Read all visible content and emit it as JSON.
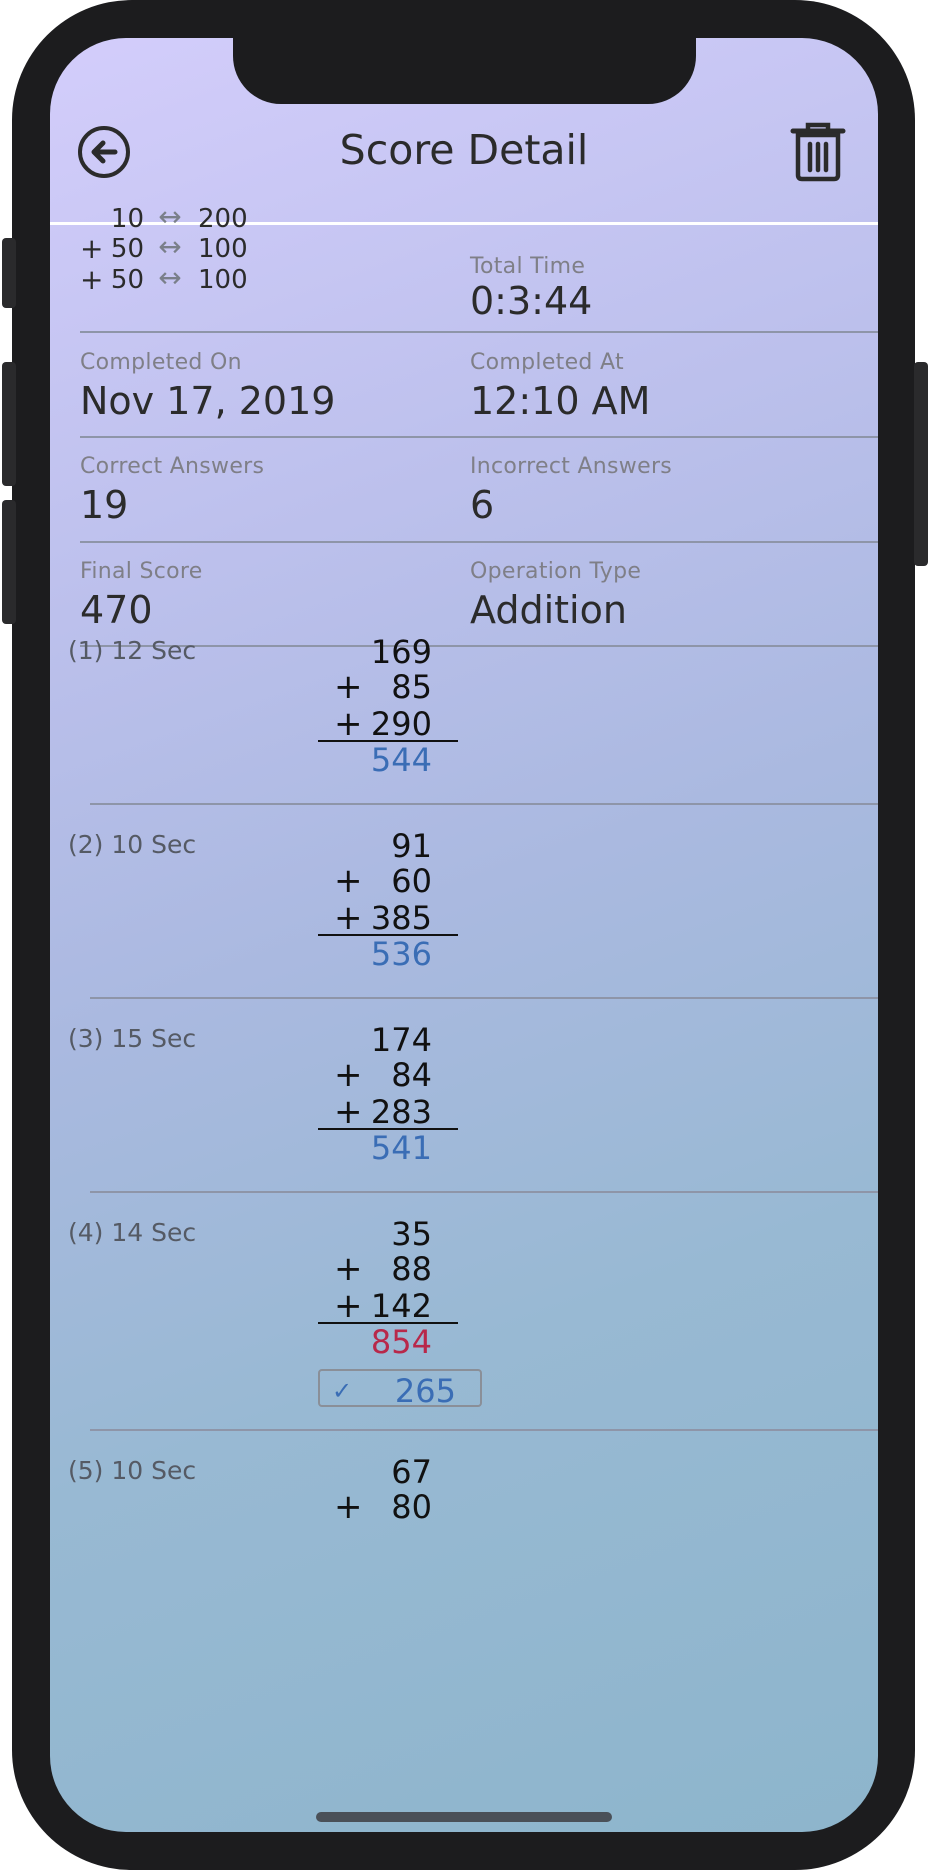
{
  "header": {
    "title": "Score Detail",
    "back_icon": "back-arrow-circle-icon",
    "delete_icon": "trash-icon"
  },
  "ranges": [
    {
      "plus": "",
      "low": "10",
      "high": "200"
    },
    {
      "plus": "+",
      "low": "50",
      "high": "100"
    },
    {
      "plus": "+",
      "low": "50",
      "high": "100"
    }
  ],
  "range_arrow": "↔",
  "stats": {
    "total_time_label": "Total Time",
    "total_time": "0:3:44",
    "completed_on_label": "Completed On",
    "completed_on": "Nov 17, 2019",
    "completed_at_label": "Completed At",
    "completed_at": "12:10 AM",
    "correct_label": "Correct Answers",
    "correct": "19",
    "incorrect_label": "Incorrect Answers",
    "incorrect": "6",
    "final_score_label": "Final Score",
    "final_score": "470",
    "operation_label": "Operation Type",
    "operation": "Addition"
  },
  "questions": [
    {
      "header": "(1)  12 Sec",
      "operands": [
        "169",
        "85",
        "290"
      ],
      "answer": "544",
      "answer_correct": true
    },
    {
      "header": "(2)  10 Sec",
      "operands": [
        "91",
        "60",
        "385"
      ],
      "answer": "536",
      "answer_correct": true
    },
    {
      "header": "(3)  15 Sec",
      "operands": [
        "174",
        "84",
        "283"
      ],
      "answer": "541",
      "answer_correct": true
    },
    {
      "header": "(4)  14 Sec",
      "operands": [
        "35",
        "88",
        "142"
      ],
      "answer": "854",
      "answer_correct": false,
      "correct_answer": "265",
      "check_glyph": "✓"
    },
    {
      "header": "(5)  10 Sec",
      "operands": [
        "67",
        "80"
      ]
    }
  ],
  "operator": "+",
  "colors": {
    "correct": "#3a6db5",
    "incorrect": "#b8284a"
  }
}
